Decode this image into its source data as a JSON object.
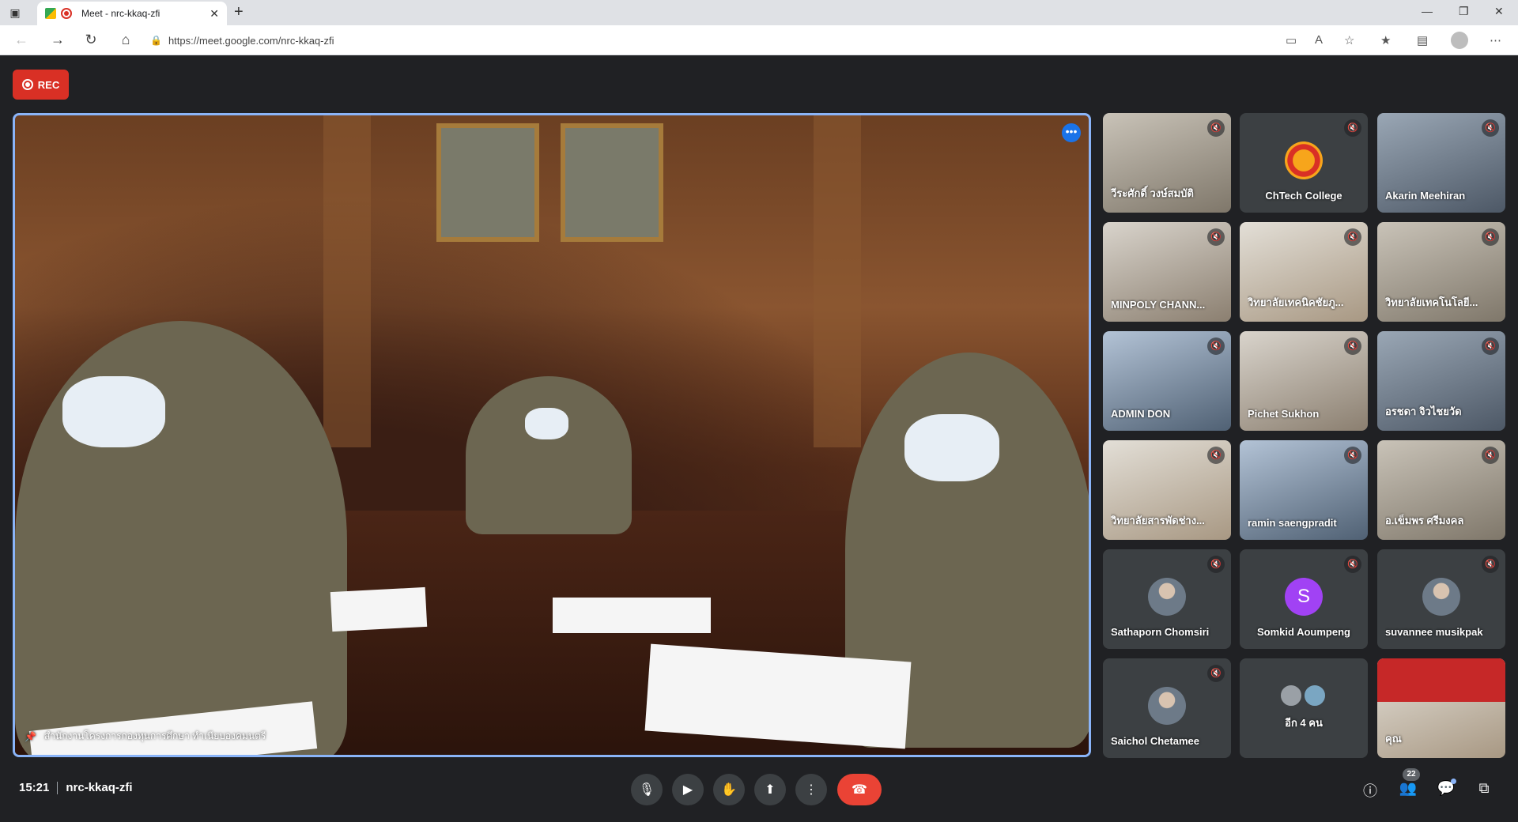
{
  "browser": {
    "tab_title": "Meet - nrc-kkaq-zfi",
    "url": "https://meet.google.com/nrc-kkaq-zfi"
  },
  "meeting": {
    "rec_label": "REC",
    "main_speaker_name": "สำนักงานโครงการกองทุนการศึกษา ทำเนียบองคมนตรี",
    "time": "15:21",
    "code": "nrc-kkaq-zfi",
    "participant_count": "22"
  },
  "tiles": [
    {
      "name": "วีระศักดิ์ วงษ์สมบัติ",
      "kind": "photo"
    },
    {
      "name": "ChTech College",
      "kind": "logo"
    },
    {
      "name": "Akarin Meehiran",
      "kind": "photo2"
    },
    {
      "name": "MINPOLY CHANN...",
      "kind": "photo3"
    },
    {
      "name": "วิทยาลัยเทคนิคชัยภู...",
      "kind": "photo5"
    },
    {
      "name": "วิทยาลัยเทคโนโลยี...",
      "kind": "photo"
    },
    {
      "name": "ADMIN DON",
      "kind": "photo4"
    },
    {
      "name": "Pichet Sukhon",
      "kind": "photo3"
    },
    {
      "name": "อรชดา จิวไชยวัด",
      "kind": "photo2"
    },
    {
      "name": "วิทยาลัยสารพัดช่าง...",
      "kind": "photo5"
    },
    {
      "name": "ramin saengpradit",
      "kind": "photo4"
    },
    {
      "name": "อ.เข็มพร ศรีมงคล",
      "kind": "photo"
    },
    {
      "name": "Sathaporn Chomsiri",
      "kind": "avatar"
    },
    {
      "name": "Somkid Aoumpeng",
      "kind": "letter",
      "letter": "S"
    },
    {
      "name": "suvannee musikpak",
      "kind": "avatar"
    },
    {
      "name": "Saichol Chetamee",
      "kind": "avatar"
    },
    {
      "name": "อีก 4 คน",
      "kind": "more"
    },
    {
      "name": "คุณ",
      "kind": "self"
    }
  ],
  "colors": {
    "accent": "#8ab4f8",
    "rec": "#d93025",
    "hangup": "#ea4335",
    "letter_avatar": "#a142f4"
  }
}
